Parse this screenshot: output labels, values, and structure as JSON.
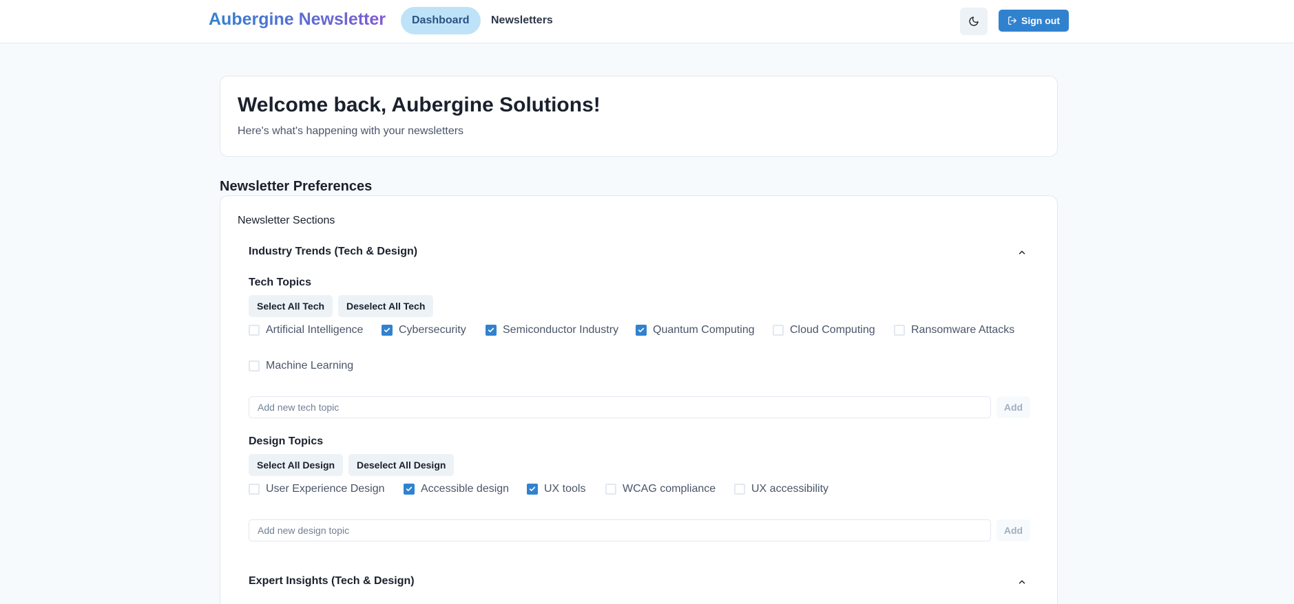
{
  "nav": {
    "brand": "Aubergine Newsletter",
    "links": [
      {
        "label": "Dashboard",
        "active": true
      },
      {
        "label": "Newsletters",
        "active": false
      }
    ],
    "theme_icon": "moon-icon",
    "signout_icon": "sign-out-icon",
    "signout_label": "Sign out"
  },
  "welcome": {
    "title": "Welcome back, Aubergine Solutions!",
    "subtitle": "Here's what's happening with your newsletters"
  },
  "preferences": {
    "heading": "Newsletter Preferences",
    "sections_label": "Newsletter Sections",
    "accordions": [
      {
        "title": "Industry Trends (Tech & Design)",
        "expanded": true,
        "groups": [
          {
            "title": "Tech Topics",
            "select_all_label": "Select All Tech",
            "deselect_all_label": "Deselect All Tech",
            "topics": [
              {
                "label": "Artificial Intelligence",
                "checked": false
              },
              {
                "label": "Cybersecurity",
                "checked": true
              },
              {
                "label": "Semiconductor Industry",
                "checked": true
              },
              {
                "label": "Quantum Computing",
                "checked": true
              },
              {
                "label": "Cloud Computing",
                "checked": false
              },
              {
                "label": "Ransomware Attacks",
                "checked": false
              },
              {
                "label": "Machine Learning",
                "checked": false
              }
            ],
            "input_placeholder": "Add new tech topic",
            "input_value": "",
            "add_label": "Add"
          },
          {
            "title": "Design Topics",
            "select_all_label": "Select All Design",
            "deselect_all_label": "Deselect All Design",
            "topics": [
              {
                "label": "User Experience Design",
                "checked": false
              },
              {
                "label": "Accessible design",
                "checked": true
              },
              {
                "label": "UX tools",
                "checked": true
              },
              {
                "label": "WCAG compliance",
                "checked": false
              },
              {
                "label": "UX accessibility",
                "checked": false
              }
            ],
            "input_placeholder": "Add new design topic",
            "input_value": "",
            "add_label": "Add"
          }
        ]
      },
      {
        "title": "Expert Insights (Tech & Design)",
        "expanded": true
      }
    ]
  },
  "colors": {
    "primary": "#3182ce",
    "active_nav_bg": "#bee3f8",
    "page_bg": "#f7fafc",
    "border": "#e2e8f0"
  }
}
